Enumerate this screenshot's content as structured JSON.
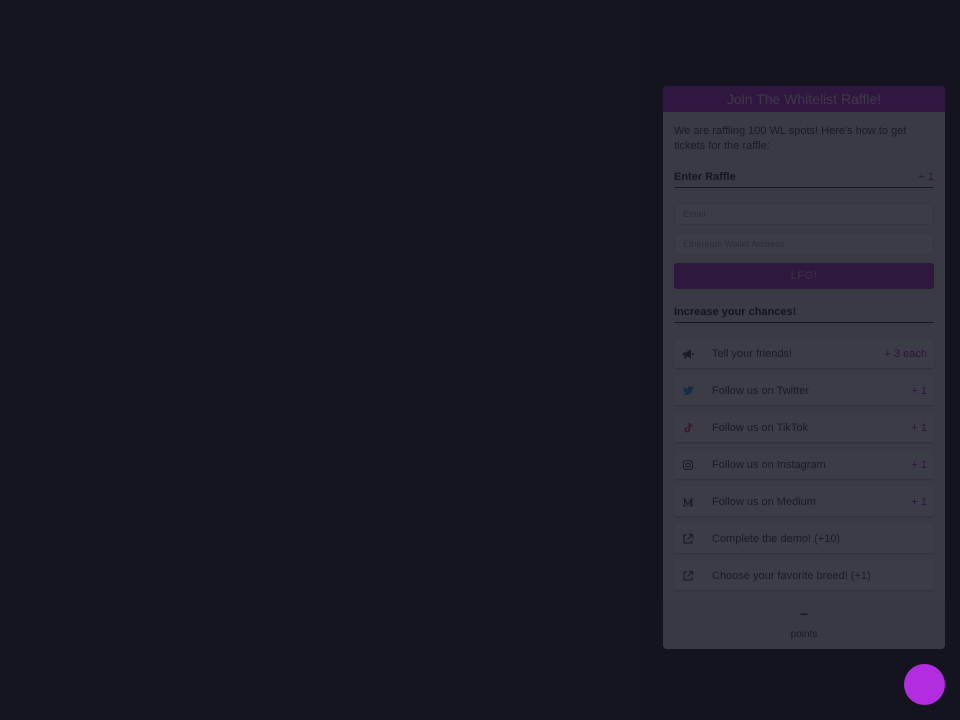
{
  "widget": {
    "title": "Join The Whitelist Raffle!",
    "intro": "We are raffling 100 WL spots! Here's how to get tickets for the raffle:",
    "enter": {
      "heading": "Enter Raffle",
      "points": "+ 1",
      "email_placeholder": "Email",
      "wallet_placeholder": "Ethereum Wallet Address",
      "submit_label": "LFG!"
    },
    "increase": {
      "heading": "Increase your chances!"
    },
    "tasks": [
      {
        "label": "Tell your friends!",
        "points": "+ 3 each",
        "icon": "megaphone-icon"
      },
      {
        "label": "Follow us on Twitter",
        "points": "+ 1",
        "icon": "twitter-icon"
      },
      {
        "label": "Follow us on TikTok",
        "points": "+ 1",
        "icon": "tiktok-icon"
      },
      {
        "label": "Follow us on Instagram",
        "points": "+ 1",
        "icon": "instagram-icon"
      },
      {
        "label": "Follow us on Medium",
        "points": "+ 1",
        "icon": "medium-icon"
      },
      {
        "label": "Complete the demo! (+10)",
        "points": "",
        "icon": "external-link-icon"
      },
      {
        "label": "Choose your favorite breed! (+1)",
        "points": "",
        "icon": "external-link-icon"
      }
    ],
    "footer": {
      "points_value": "–",
      "points_label": "points"
    }
  },
  "colors": {
    "accent": "#b028d3",
    "backdrop": "#1b1b24",
    "twitter": "#1da1f2",
    "tiktok": "#ee1d52"
  }
}
